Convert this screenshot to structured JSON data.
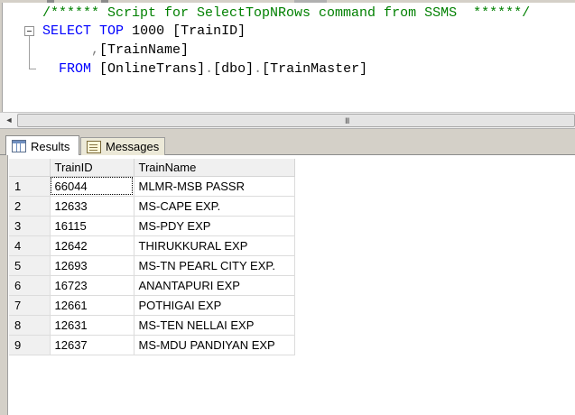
{
  "editor": {
    "comment": "/****** Script for SelectTopNRows command from SSMS  ******/",
    "line1": {
      "kw_select": "SELECT",
      "kw_top": "TOP",
      "number": "1000",
      "col": "[TrainID]"
    },
    "line2": {
      "comma": ",",
      "col": "[TrainName]"
    },
    "line3": {
      "kw_from": "FROM",
      "db": "[OnlineTrans]",
      "dot1": ".",
      "schema": "[dbo]",
      "dot2": ".",
      "table": "[TrainMaster]"
    }
  },
  "scrollbar": {
    "left_arrow": "◄",
    "grip": "III"
  },
  "tabs": [
    {
      "label": "Results",
      "icon": "grid-icon",
      "active": true
    },
    {
      "label": "Messages",
      "icon": "messages-icon",
      "active": false
    }
  ],
  "results": {
    "columns": [
      "TrainID",
      "TrainName"
    ],
    "rows": [
      {
        "n": "1",
        "id": "66044",
        "name": "MLMR-MSB PASSR"
      },
      {
        "n": "2",
        "id": "12633",
        "name": "MS-CAPE EXP."
      },
      {
        "n": "3",
        "id": "16115",
        "name": "MS-PDY EXP"
      },
      {
        "n": "4",
        "id": "12642",
        "name": "THIRUKKURAL EXP"
      },
      {
        "n": "5",
        "id": "12693",
        "name": "MS-TN PEARL CITY EXP."
      },
      {
        "n": "6",
        "id": "16723",
        "name": "ANANTAPURI EXP"
      },
      {
        "n": "7",
        "id": "12661",
        "name": "POTHIGAI EXP"
      },
      {
        "n": "8",
        "id": "12631",
        "name": "MS-TEN NELLAI EXP"
      },
      {
        "n": "9",
        "id": "12637",
        "name": "MS-MDU PANDIYAN EXP"
      }
    ]
  },
  "colors": {
    "comment": "#008000",
    "keyword": "#0000ff",
    "operator": "#808080",
    "identifier": "#000000"
  }
}
